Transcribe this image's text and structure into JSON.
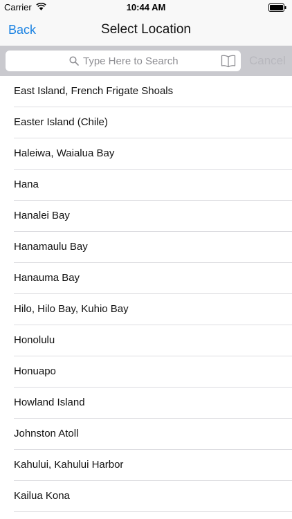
{
  "status_bar": {
    "carrier": "Carrier",
    "time": "10:44 AM"
  },
  "nav": {
    "back_label": "Back",
    "title": "Select Location"
  },
  "search": {
    "placeholder": "Type Here to Search",
    "cancel_label": "Cancel"
  },
  "icons": {
    "wifi": "wifi-icon",
    "battery": "battery-icon",
    "search": "search-icon",
    "bookmark": "book-icon"
  },
  "colors": {
    "accent": "#1a82e2",
    "bar_background": "#f8f8f8",
    "search_background": "#c9c9ce",
    "cancel_disabled": "#b8b8be"
  },
  "locations": [
    "East Island, French Frigate Shoals",
    "Easter Island (Chile)",
    "Haleiwa, Waialua Bay",
    "Hana",
    "Hanalei Bay",
    "Hanamaulu Bay",
    "Hanauma Bay",
    "Hilo, Hilo Bay, Kuhio Bay",
    "Honolulu",
    "Honuapo",
    "Howland Island",
    "Johnston Atoll",
    "Kahului, Kahului Harbor",
    "Kailua Kona"
  ]
}
